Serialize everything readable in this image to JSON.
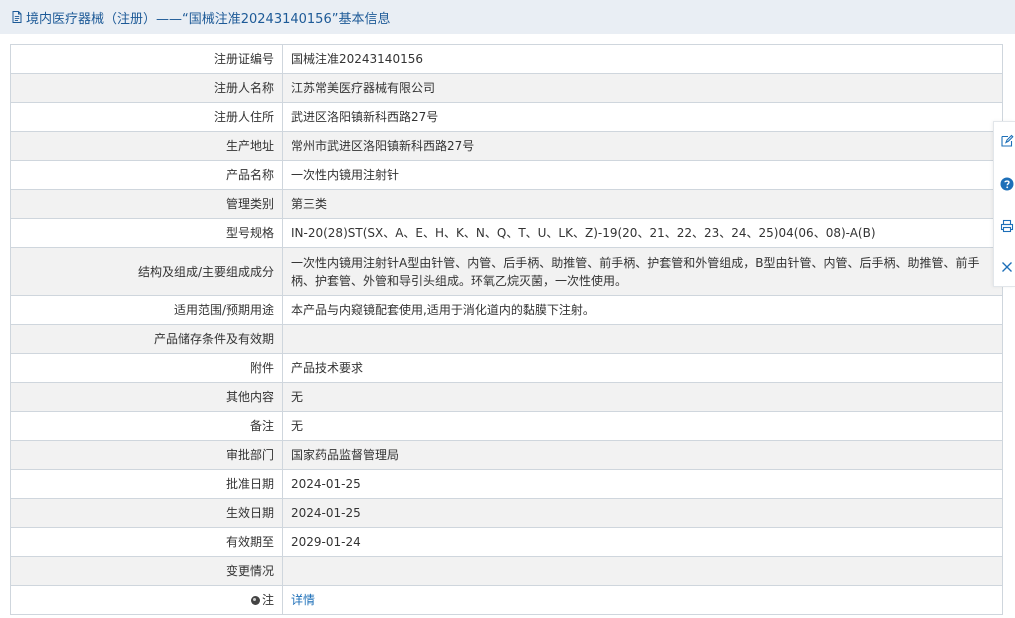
{
  "header": {
    "title": "境内医疗器械（注册）——“国械注准20243140156”基本信息"
  },
  "rows": [
    {
      "label": "注册证编号",
      "value": "国械注准20243140156"
    },
    {
      "label": "注册人名称",
      "value": "江苏常美医疗器械有限公司"
    },
    {
      "label": "注册人住所",
      "value": "武进区洛阳镇新科西路27号"
    },
    {
      "label": "生产地址",
      "value": "常州市武进区洛阳镇新科西路27号"
    },
    {
      "label": "产品名称",
      "value": "一次性内镜用注射针"
    },
    {
      "label": "管理类别",
      "value": "第三类"
    },
    {
      "label": "型号规格",
      "value": "IN-20(28)ST(SX、A、E、H、K、N、Q、T、U、LK、Z)-19(20、21、22、23、24、25)04(06、08)-A(B)"
    },
    {
      "label": "结构及组成/主要组成成分",
      "value": "一次性内镜用注射针A型由针管、内管、后手柄、助推管、前手柄、护套管和外管组成，B型由针管、内管、后手柄、助推管、前手柄、护套管、外管和导引头组成。环氧乙烷灭菌，一次性使用。"
    },
    {
      "label": "适用范围/预期用途",
      "value": "本产品与内窥镜配套使用,适用于消化道内的黏膜下注射。"
    },
    {
      "label": "产品储存条件及有效期",
      "value": ""
    },
    {
      "label": "附件",
      "value": "产品技术要求"
    },
    {
      "label": "其他内容",
      "value": "无"
    },
    {
      "label": "备注",
      "value": "无"
    },
    {
      "label": "审批部门",
      "value": "国家药品监督管理局"
    },
    {
      "label": "批准日期",
      "value": "2024-01-25"
    },
    {
      "label": "生效日期",
      "value": "2024-01-25"
    },
    {
      "label": "有效期至",
      "value": "2029-01-24"
    },
    {
      "label": "变更情况",
      "value": ""
    }
  ],
  "note_row": {
    "label": "注",
    "link_text": "详情"
  },
  "icons": {
    "title": "document-icon",
    "note": "note-dot-icon",
    "side": [
      "edit-icon",
      "help-icon",
      "print-icon",
      "close-icon"
    ]
  },
  "colors": {
    "title_bar_bg": "#e9eef4",
    "title_text": "#1d5a97",
    "alt_row_bg": "#f2f2f2",
    "link": "#1d6fb8",
    "help_icon": "#1d6fb8"
  }
}
